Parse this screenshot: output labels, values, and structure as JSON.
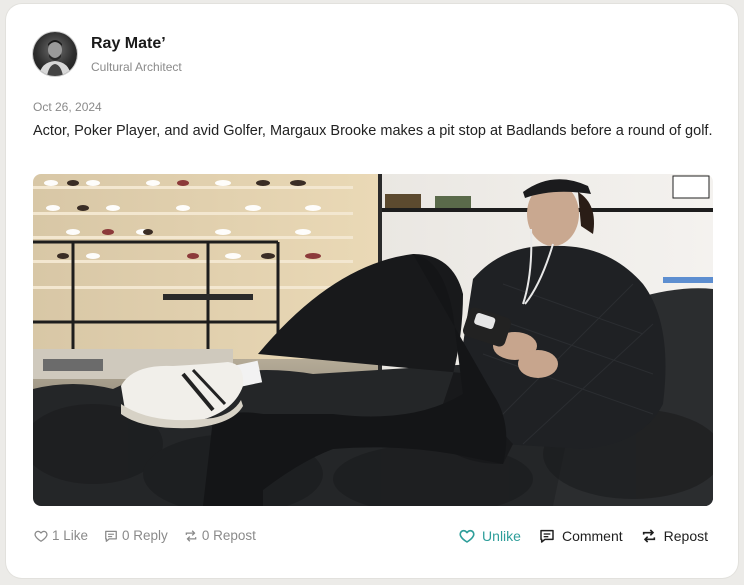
{
  "post": {
    "author_name": "Ray Mate’",
    "author_title": "Cultural Architect",
    "date": "Oct 26, 2024",
    "text": "Actor, Poker Player, and avid Golfer, Margaux Brooke makes a pit stop at Badlands before a round of golf."
  },
  "stats": {
    "likes": "1 Like",
    "replies": "0 Reply",
    "reposts": "0 Repost"
  },
  "actions": {
    "unlike": "Unlike",
    "comment": "Comment",
    "repost": "Repost"
  },
  "icons": {
    "stat_like": "heart-outline-icon",
    "stat_reply": "speech-bubble-icon",
    "stat_repost": "repost-arrows-icon",
    "unlike": "heart-outline-icon",
    "comment": "comment-bubble-icon",
    "repost": "repost-arrows-icon"
  },
  "colors": {
    "accent": "#2e9e9a",
    "muted_text": "#8a8a8a",
    "card_bg": "#ffffff",
    "page_bg": "#ecebe8"
  }
}
